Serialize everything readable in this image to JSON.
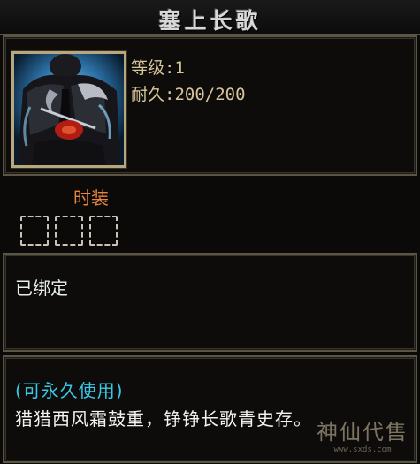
{
  "item": {
    "name": "塞上长歌",
    "icon": "character-portrait-dark-armor",
    "stats": {
      "level": "等级:1",
      "durability": "耐久:200/200"
    }
  },
  "fashion": {
    "label": "时装",
    "slots": 3
  },
  "binding": {
    "status": "已绑定"
  },
  "description": {
    "usage": "(可永久使用)",
    "flavor": "猎猎西风霜鼓重，铮铮长歌青史存。"
  },
  "watermark": {
    "logo": "神仙代售",
    "url": "www.sxds.com"
  },
  "colors": {
    "title": "#d8d8d8",
    "stat": "#d8c49a",
    "fashion_label": "#e9853f",
    "usage": "#39c9e6",
    "border": "#5b5546"
  }
}
